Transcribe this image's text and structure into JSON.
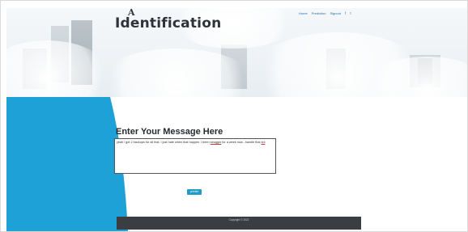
{
  "header": {
    "logo_text": "A",
    "title": "Identification",
    "nav": [
      "Home",
      "Prediction",
      "Signout"
    ],
    "social": [
      "f",
      "t"
    ]
  },
  "main": {
    "heading": "Enter Your Message Here",
    "message_parts": [
      "yeah i got 2 backups for all that. i just hate when that happen. i been ",
      "struggln",
      " for a week now...handle that ",
      "shi"
    ],
    "predict_label": "predict"
  },
  "footer": {
    "copyright": "Copyright © 2022"
  },
  "colors": {
    "accent_blue": "#1f9cc6",
    "shape_blue": "#1ea1d6",
    "footer_bg": "#3a3d42",
    "heading": "#252a2e"
  }
}
